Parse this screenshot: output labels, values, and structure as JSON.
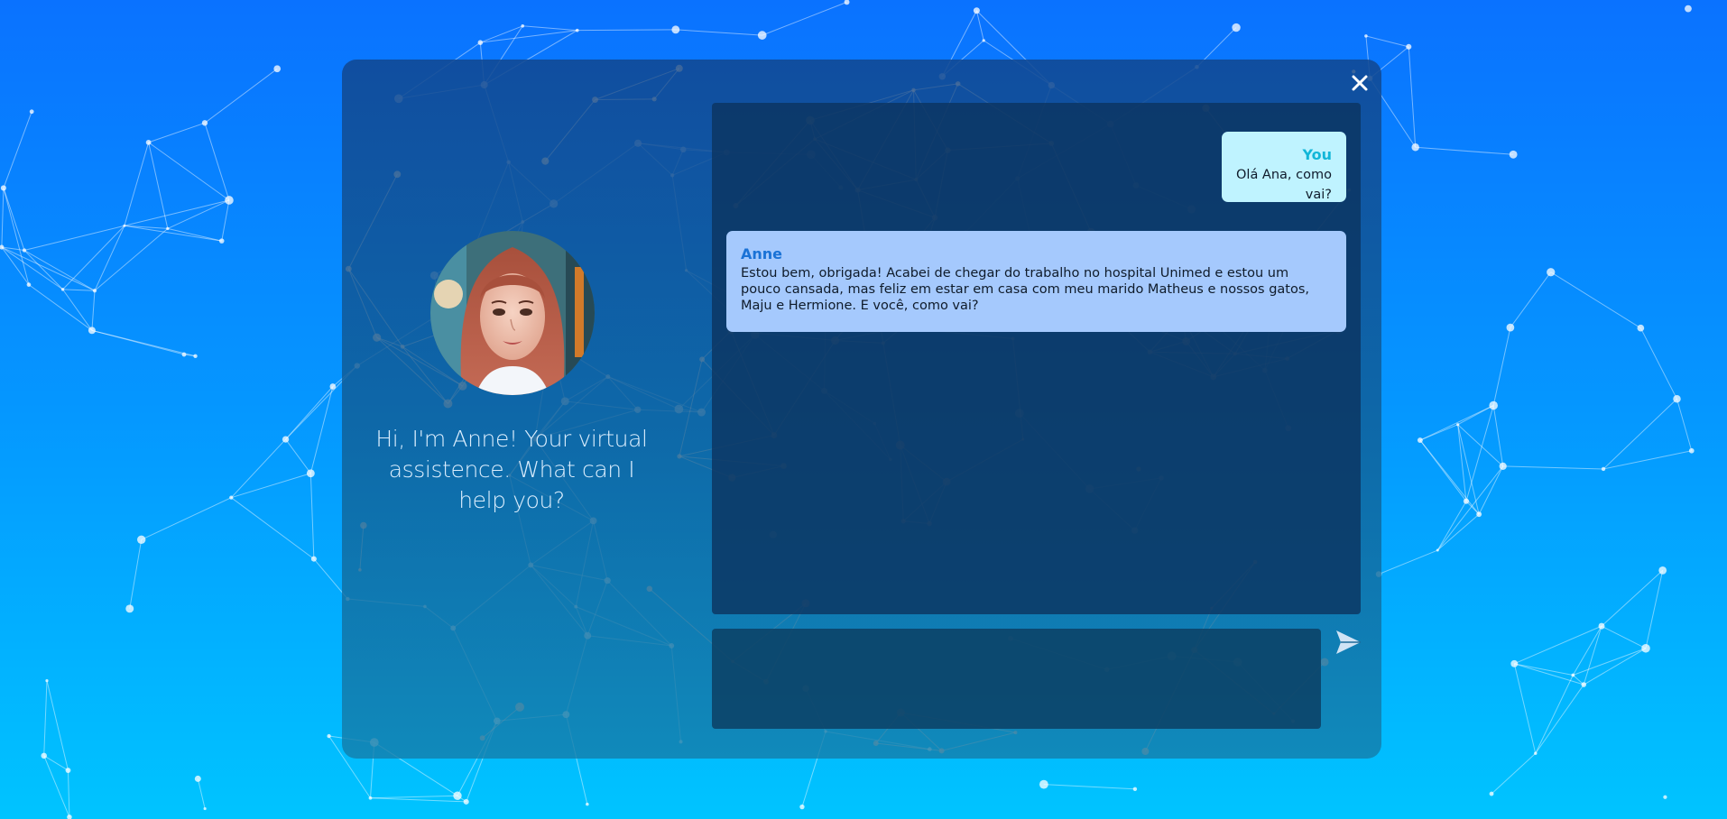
{
  "colors": {
    "bg_top": "#0a72ff",
    "bg_bottom": "#00c4ff",
    "user_bubble": "#bff3ff",
    "user_name": "#12b6d8",
    "bot_bubble": "#a5c9fd",
    "bot_name": "#1a72d6"
  },
  "icons": {
    "close": "close-icon",
    "send": "send-icon",
    "avatar": "avatar-portrait"
  },
  "assistant": {
    "greeting": "Hi, I'm Anne! Your virtual assistence. What can I help you?"
  },
  "chat": {
    "messages": [
      {
        "sender": "You",
        "text": "Olá Ana, como vai?"
      },
      {
        "sender": "Anne",
        "text": "Estou bem, obrigada! Acabei de chegar do trabalho no hospital Unimed e estou um pouco cansada, mas feliz em estar em casa com meu marido Matheus e nossos gatos, Maju e Hermione. E você, como vai?"
      }
    ]
  },
  "input": {
    "value": "",
    "placeholder": ""
  }
}
